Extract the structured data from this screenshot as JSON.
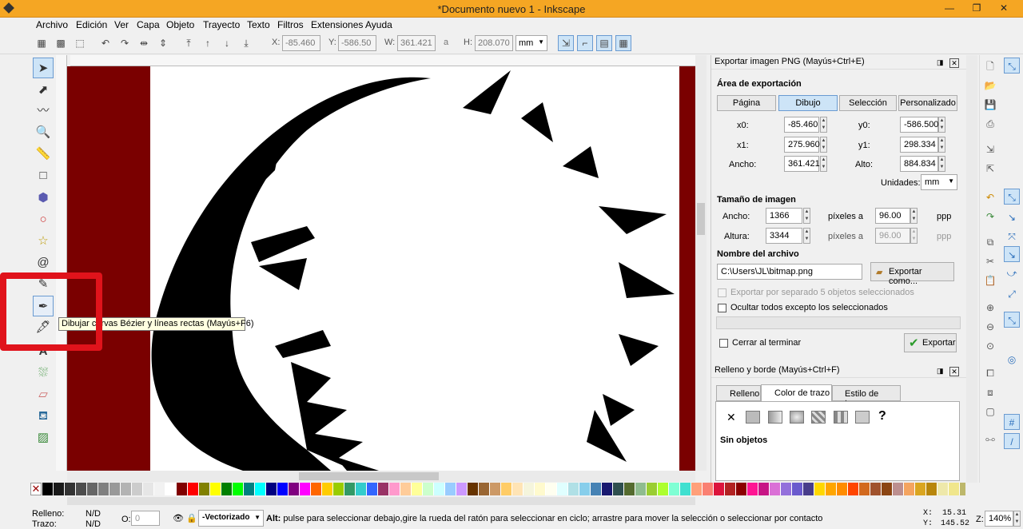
{
  "window": {
    "title": "*Documento nuevo 1 - Inkscape"
  },
  "menu": [
    "Archivo",
    "Edición",
    "Ver",
    "Capa",
    "Objeto",
    "Trayecto",
    "Texto",
    "Filtros",
    "Extensiones",
    "Ayuda"
  ],
  "selbar": {
    "x_label": "X:",
    "x": "-85.460",
    "y_label": "Y:",
    "y": "-586.50",
    "w_label": "W:",
    "w": "361.421",
    "h_label": "H:",
    "h": "208.070",
    "unit": "mm"
  },
  "tooltip": "Dibujar curvas Bézier y líneas rectas (Mayús+F6)",
  "export_panel": {
    "title": "Exportar imagen PNG (Mayús+Ctrl+E)",
    "area_heading": "Área de exportación",
    "area_tabs": [
      "Página",
      "Dibujo",
      "Selección",
      "Personalizado"
    ],
    "selected_tab": "Dibujo",
    "x0_label": "x0:",
    "x0": "-85.460",
    "y0_label": "y0:",
    "y0": "-586.500",
    "x1_label": "x1:",
    "x1": "275.960",
    "y1_label": "y1:",
    "y1": "298.334",
    "width_label": "Ancho:",
    "width": "361.421",
    "height_label": "Alto:",
    "height": "884.834",
    "units_label": "Unidades:",
    "units": "mm",
    "size_heading": "Tamaño de imagen",
    "img_width_label": "Ancho:",
    "img_width": "1366",
    "img_height_label": "Altura:",
    "img_height": "3344",
    "px_at": "píxeles a",
    "dpi_x": "96.00",
    "dpi_y": "96.00",
    "ppp": "ppp",
    "filename_heading": "Nombre del archivo",
    "filename": "C:\\Users\\JL\\bitmap.png",
    "export_as": "Exportar como...",
    "batch_export": "Exportar por separado 5 objetos seleccionados",
    "hide_all": "Ocultar todos excepto los seleccionados",
    "close_when_done": "Cerrar al terminar",
    "export_button": "Exportar"
  },
  "fill_panel": {
    "title": "Relleno y borde (Mayús+Ctrl+F)",
    "tabs": [
      "Relleno",
      "Color de trazo",
      "Estilo de trazo"
    ],
    "no_objects": "Sin objetos",
    "help": "?"
  },
  "status": {
    "fill_label": "Relleno:",
    "fill_value": "N/D",
    "stroke_label": "Trazo:",
    "stroke_value": "N/D",
    "opacity_label": "O:",
    "opacity": "0",
    "layer": "-Vectorizado",
    "message_bold": "Alt:",
    "message": " pulse para seleccionar debajo,gire la rueda del ratón para seleccionar en ciclo; arrastre para mover la selección o seleccionar por contacto",
    "x_label": "X:",
    "x": "15.31",
    "y_label": "Y:",
    "y": "145.52",
    "zoom_label": "Z:",
    "zoom": "140%"
  },
  "palette_colors": [
    "#000000",
    "#1a1a1a",
    "#333333",
    "#4d4d4d",
    "#666666",
    "#808080",
    "#999999",
    "#b3b3b3",
    "#cccccc",
    "#e6e6e6",
    "#f2f2f2",
    "#ffffff",
    "#800000",
    "#ff0000",
    "#808000",
    "#ffff00",
    "#008000",
    "#00ff00",
    "#008080",
    "#00ffff",
    "#000080",
    "#0000ff",
    "#800080",
    "#ff00ff",
    "#ff6600",
    "#ffcc00",
    "#99cc00",
    "#339966",
    "#33cccc",
    "#3366ff",
    "#993366",
    "#ff99cc",
    "#ffcc99",
    "#ffff99",
    "#ccffcc",
    "#ccffff",
    "#99ccff",
    "#cc99ff",
    "#663300",
    "#996633",
    "#cc9966",
    "#ffcc66",
    "#ffe4b5",
    "#f5f5dc",
    "#fffacd",
    "#fffff0",
    "#e0ffff",
    "#b0e0e6",
    "#87ceeb",
    "#4682b4",
    "#191970",
    "#2f4f4f",
    "#556b2f",
    "#8fbc8f",
    "#9acd32",
    "#adff2f",
    "#7fffd4",
    "#40e0d0",
    "#ffa07a",
    "#fa8072",
    "#dc143c",
    "#b22222",
    "#8b0000",
    "#ff1493",
    "#c71585",
    "#da70d6",
    "#9370db",
    "#6a5acd",
    "#483d8b",
    "#ffd700",
    "#ffa500",
    "#ff8c00",
    "#ff4500",
    "#d2691e",
    "#a0522d",
    "#8b4513",
    "#bc8f8f",
    "#f4a460",
    "#daa520",
    "#b8860b",
    "#eee8aa",
    "#f0e68c",
    "#bdb76b"
  ]
}
